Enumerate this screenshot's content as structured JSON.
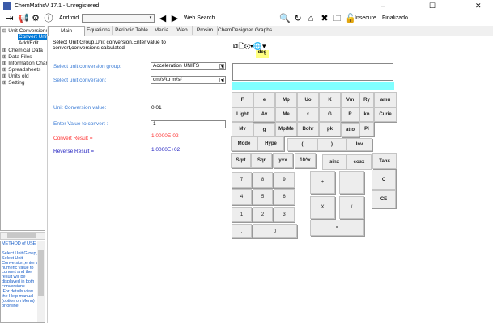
{
  "window": {
    "title": "ChemMathsV 17.1 - Unregistered",
    "min": "–",
    "max": "☐",
    "close": "✕"
  },
  "toolbar": {
    "android_label": "Android",
    "web_search": "Web Search",
    "insecure": "Insecure",
    "finalizado": "Finalizado"
  },
  "tree": {
    "items": [
      "Unit Conversions",
      "Convert Unit",
      "Add/Edit",
      "Chemical Data",
      "Data Files",
      "Information Charts",
      "Spreadsheets",
      "Units old",
      "Setting"
    ]
  },
  "method": {
    "text": "METHOD of USE :\n\nSelect Unit Group, Select Unit Conversion,enter a numeric value to convert and the result will be displayed in both conversions.\n For details view the Help manual (option on Menu) or online"
  },
  "tabs": [
    "Main Functions",
    "Equations",
    "Periodic Table",
    "Media",
    "Web",
    "Prosim",
    "ChemDesigner",
    "Graphs"
  ],
  "main": {
    "instructions": "Select Unit Group,Unit conversion,Enter value to convert,conversions calculated",
    "group_label": "Select unit conversion group:",
    "group_value": "Acceleration UNITS",
    "conv_label": "Select unit conversion:",
    "conv_value": "cm/s²to  m/s²",
    "ucv_label": "Unit Conversion value:",
    "ucv_value": "0,01",
    "enter_label": "Enter Value to convert :",
    "enter_value": "1",
    "convert_label": "Convert Result =",
    "convert_value": "1,0000E-02",
    "reverse_label": "Reverse Result =",
    "reverse_value": "1,0000E+02"
  },
  "calc": {
    "deg": "deg",
    "buttons": [
      "F",
      "e",
      "Mp",
      "Uo",
      "K",
      "Vm",
      "Ry",
      "amu",
      "Light",
      "Av",
      "Me",
      "ε",
      "G",
      "R",
      "kn",
      "Curie",
      "Mv",
      "g",
      "Mp/Me",
      "Bohr",
      "pk",
      "atto",
      "Pi",
      "Mode",
      "Hype",
      "(",
      ")",
      "Inv",
      "Sqrt",
      "Sqr",
      "y^x",
      "10^x",
      "sinx",
      "cosx",
      "Tanx",
      "7",
      "8",
      "9",
      "4",
      "5",
      "6",
      "1",
      "2",
      "3",
      ".",
      "0",
      "+",
      "-",
      "X",
      "/",
      "=",
      "C",
      "CE"
    ]
  },
  "colors": {
    "cyan": "#80ffff",
    "red": "#ff3030",
    "navy": "#2020c0",
    "blue": "#3a7bd5"
  }
}
